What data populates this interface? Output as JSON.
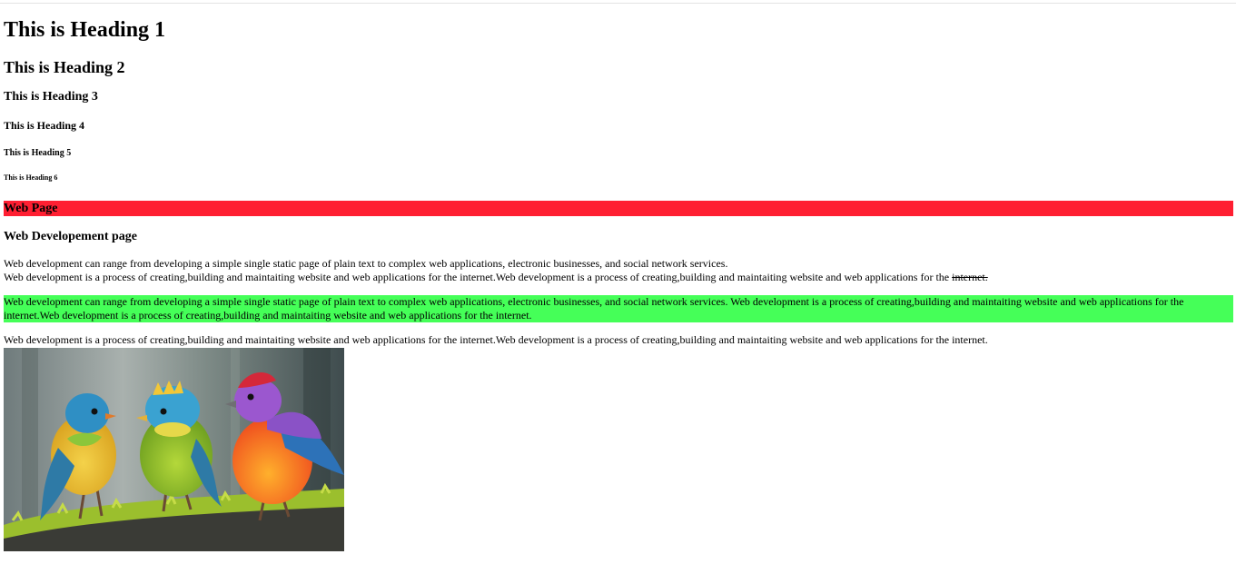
{
  "headings": {
    "h1": "This is Heading 1",
    "h2": "This is Heading 2",
    "h3": "This is Heading 3",
    "h4": "This is Heading 4",
    "h5": "This is Heading 5",
    "h6": "This is Heading 6"
  },
  "banner": {
    "text": "Web Page",
    "color": "#ff1f32"
  },
  "subheading": "Web Developement page",
  "paragraph1": {
    "line1": "Web development can range from developing a simple single static page of plain text to complex web applications, electronic businesses, and social network services.",
    "line2_prefix": "Web development is a process of creating,building and maintaiting website and web applications for the internet.Web development is a process of creating,building and maintaiting website and web applications for the ",
    "line2_struck": "internet."
  },
  "highlight": {
    "text": "Web development can range from developing a simple single static page of plain text to complex web applications, electronic businesses, and social network services. Web development is a process of creating,building and maintaiting website and web applications for the internet.Web development is a process of creating,building and maintaiting website and web applications for the internet.",
    "color": "#45ff58"
  },
  "paragraph3": "Web development is a process of creating,building and maintaiting website and web applications for the internet.Web development is a process of creating,building and maintaiting website and web applications for the internet.",
  "image": {
    "icon": "three-colorful-birds-image"
  }
}
